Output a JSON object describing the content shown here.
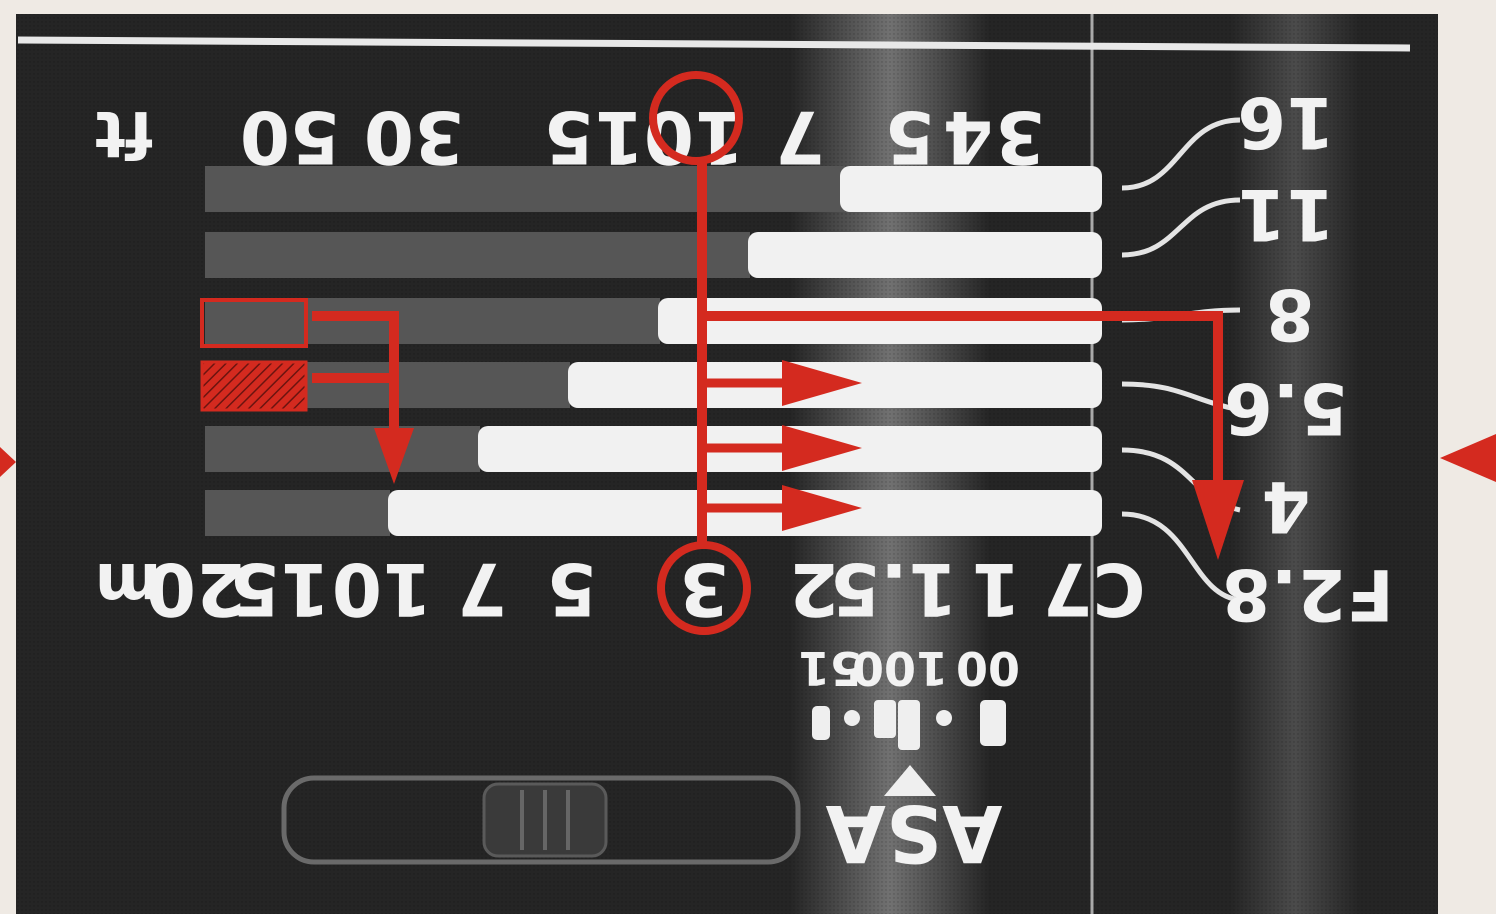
{
  "feet_scale": {
    "unit": "ft",
    "labels": [
      "3",
      "4",
      "5",
      "7",
      "10",
      "15",
      "30",
      "50"
    ],
    "highlighted": "10"
  },
  "meter_scale": {
    "unit": "m",
    "labels": [
      "C7",
      "1",
      "1.5",
      "2",
      "3",
      "5",
      "7",
      "10",
      "15",
      "20"
    ],
    "highlighted": "3"
  },
  "apertures": [
    "F2.8",
    "4",
    "5.6",
    "8",
    "11",
    "16"
  ],
  "asa": {
    "label": "ASA",
    "values": [
      "00",
      "100",
      "51"
    ]
  },
  "colors": {
    "dial": "#252525",
    "accent": "#d42a1f",
    "bar_white": "#f1f1f1",
    "bar_grey": "#565656",
    "text": "#f2f2f2"
  }
}
